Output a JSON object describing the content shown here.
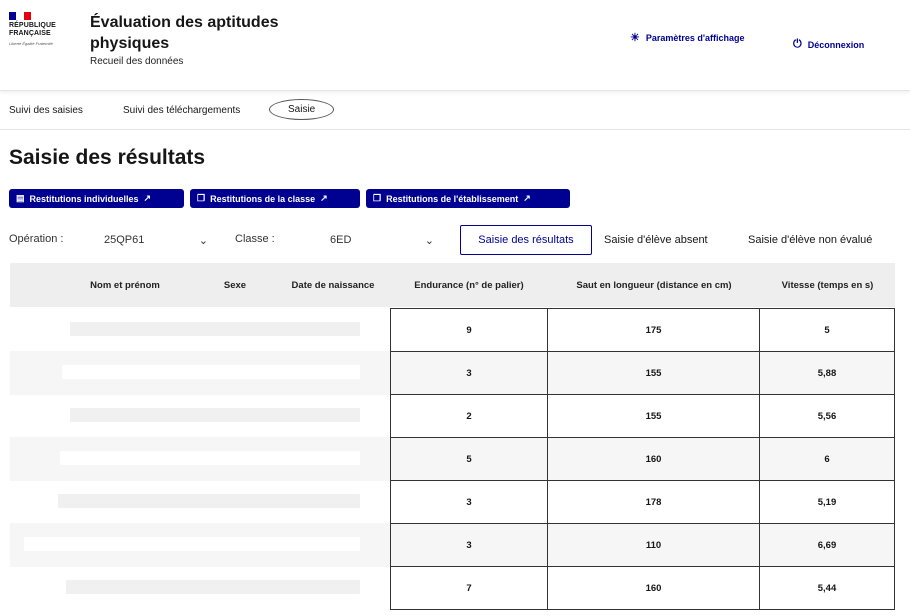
{
  "header": {
    "logo_text": "RÉPUBLIQUE FRANÇAISE",
    "logo_motto": "Liberté Égalité Fraternité",
    "flag_colors": [
      "#000091",
      "#ffffff",
      "#e1000f"
    ],
    "app_title": "Évaluation des aptitudes physiques",
    "app_subtitle": "Recueil des données",
    "settings_label": "Paramètres d'affichage",
    "settings_icon": "sun-icon",
    "logout_label": "Déconnexion",
    "logout_icon": "logout-icon"
  },
  "nav": {
    "items": [
      {
        "label": "Suivi des saisies",
        "active": false
      },
      {
        "label": "Suivi des téléchargements",
        "active": false
      },
      {
        "label": "Saisie",
        "active": true
      }
    ]
  },
  "page": {
    "title": "Saisie des résultats",
    "actions": [
      {
        "label": "Restitutions individuelles"
      },
      {
        "label": "Restitutions de la classe"
      },
      {
        "label": "Restitutions de l'établissement"
      }
    ]
  },
  "filters": {
    "operation_label": "Opération :",
    "operation_value": "25QP61",
    "classe_label": "Classe :",
    "classe_value": "6ED",
    "tabs": [
      {
        "label": "Saisie des résultats",
        "selected": true
      },
      {
        "label": "Saisie d'élève absent",
        "selected": false
      },
      {
        "label": "Saisie d'élève non évalué",
        "selected": false
      }
    ]
  },
  "table": {
    "columns": [
      "Nom et prénom",
      "Sexe",
      "Date de naissance",
      "Endurance (n° de palier)",
      "Saut en longueur (distance en cm)",
      "Vitesse (temps en s)"
    ],
    "rows": [
      {
        "endurance": "9",
        "saut": "175",
        "vitesse": "5"
      },
      {
        "endurance": "3",
        "saut": "155",
        "vitesse": "5,88"
      },
      {
        "endurance": "2",
        "saut": "155",
        "vitesse": "5,56"
      },
      {
        "endurance": "5",
        "saut": "160",
        "vitesse": "6"
      },
      {
        "endurance": "3",
        "saut": "178",
        "vitesse": "5,19"
      },
      {
        "endurance": "3",
        "saut": "110",
        "vitesse": "6,69"
      },
      {
        "endurance": "7",
        "saut": "160",
        "vitesse": "5,44"
      }
    ]
  },
  "colors": {
    "primary": "#000091",
    "header_bg": "#eeeeee"
  }
}
